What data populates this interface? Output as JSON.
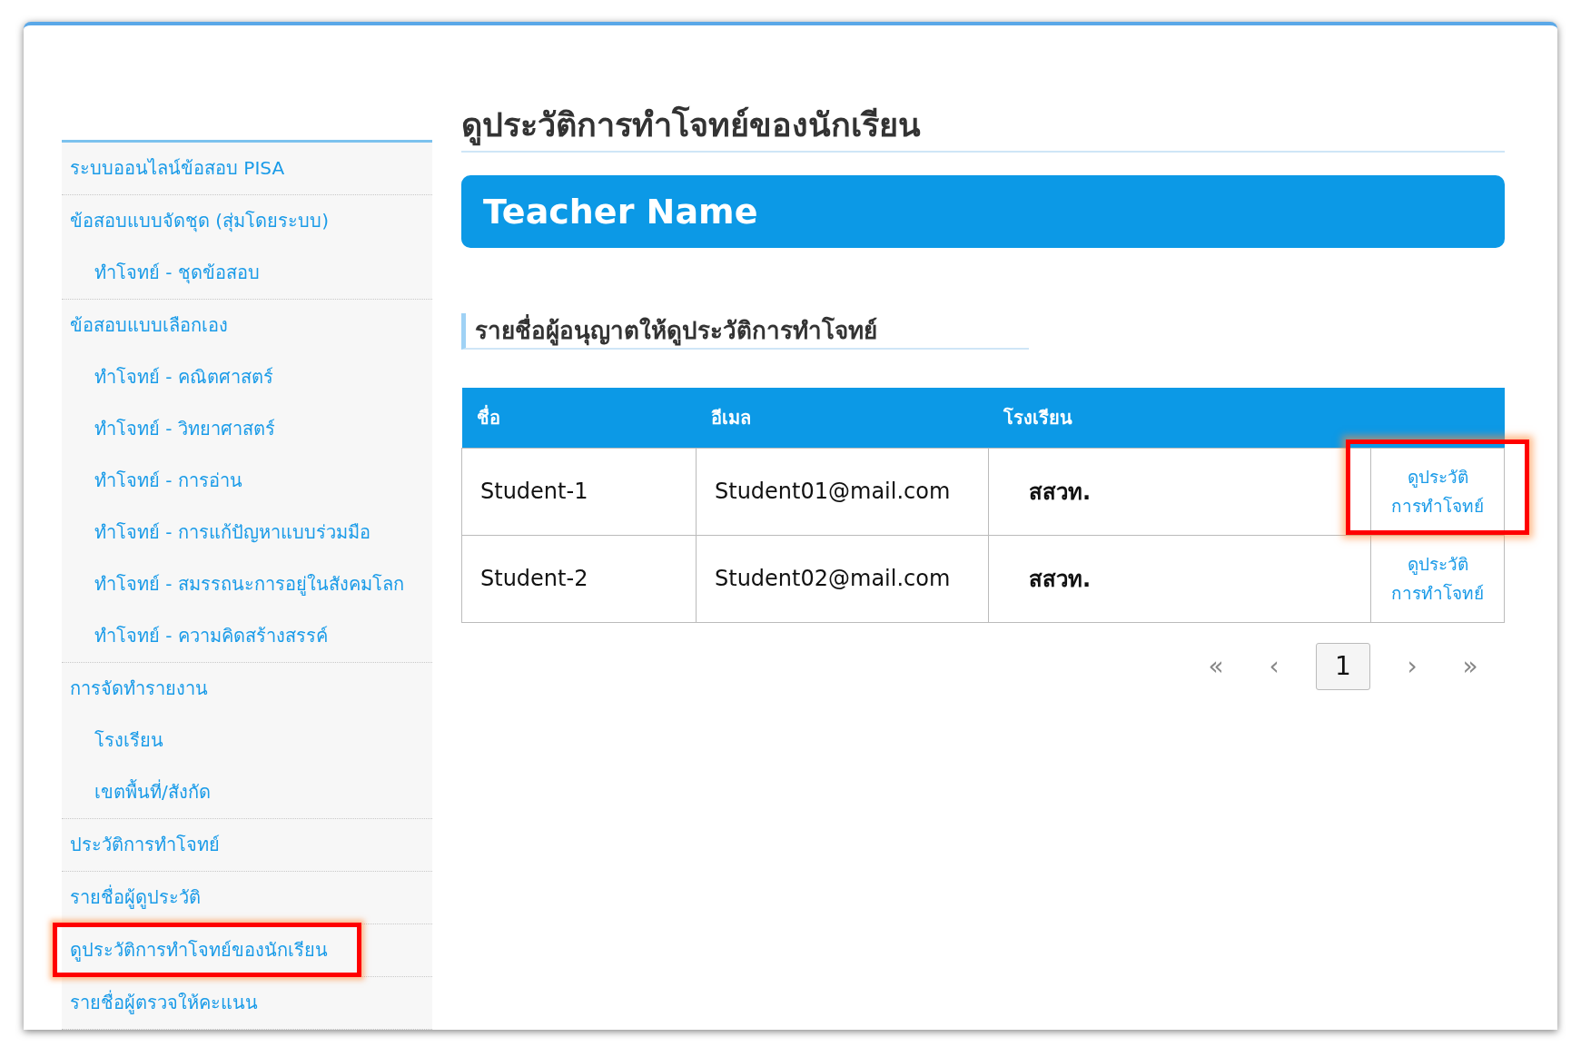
{
  "sidebar": {
    "groups": [
      {
        "label": "ระบบออนไลน์ข้อสอบ PISA",
        "highlighted": false
      },
      {
        "label": "ข้อสอบแบบจัดชุด (สุ่มโดยระบบ)",
        "highlighted": false,
        "children": [
          {
            "label": "ทำโจทย์ - ชุดข้อสอบ"
          }
        ]
      },
      {
        "label": "ข้อสอบแบบเลือกเอง",
        "highlighted": false,
        "children": [
          {
            "label": "ทำโจทย์ - คณิตศาสตร์"
          },
          {
            "label": "ทำโจทย์ - วิทยาศาสตร์"
          },
          {
            "label": "ทำโจทย์ - การอ่าน"
          },
          {
            "label": "ทำโจทย์ - การแก้ปัญหาแบบร่วมมือ"
          },
          {
            "label": "ทำโจทย์ - สมรรถนะการอยู่ในสังคมโลก"
          },
          {
            "label": "ทำโจทย์ - ความคิดสร้างสรรค์"
          }
        ]
      },
      {
        "label": "การจัดทำรายงาน",
        "highlighted": false,
        "children": [
          {
            "label": "โรงเรียน"
          },
          {
            "label": "เขตพื้นที่/สังกัด"
          }
        ]
      },
      {
        "label": "ประวัติการทำโจทย์",
        "highlighted": false
      },
      {
        "label": "รายชื่อผู้ดูประวัติ",
        "highlighted": false
      },
      {
        "label": "ดูประวัติการทำโจทย์ของนักเรียน",
        "highlighted": true
      },
      {
        "label": "รายชื่อผู้ตรวจให้คะแนน",
        "highlighted": false
      }
    ]
  },
  "page_title": "ดูประวัติการทำโจทย์ของนักเรียน",
  "banner": "Teacher Name",
  "section_title": "รายชื่อผู้อนุญาตให้ดูประวัติการทำโจทย์",
  "table": {
    "columns": [
      "ชื่อ",
      "อีเมล",
      "โรงเรียน"
    ],
    "rows": [
      {
        "name": "Student-1",
        "email": "Student01@mail.com",
        "school": "สสวท.",
        "action": [
          "ดูประวัติ",
          "การทำโจทย์"
        ],
        "highlighted": true
      },
      {
        "name": "Student-2",
        "email": "Student02@mail.com",
        "school": "สสวท.",
        "action": [
          "ดูประวัติ",
          "การทำโจทย์"
        ],
        "highlighted": false
      }
    ]
  },
  "pagination": [
    {
      "label": "«",
      "selected": false
    },
    {
      "label": "‹",
      "selected": false
    },
    {
      "label": "1",
      "selected": true
    },
    {
      "label": "›",
      "selected": false
    },
    {
      "label": "»",
      "selected": false
    }
  ]
}
